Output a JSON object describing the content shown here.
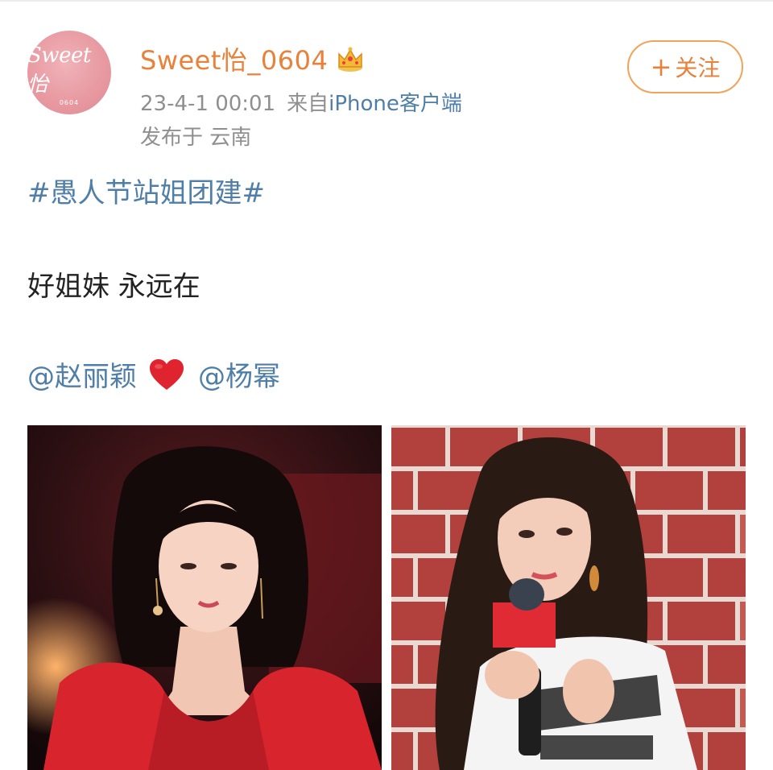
{
  "post": {
    "author": {
      "name": "Sweet怡_0604",
      "avatar_text": "Sweet怡",
      "avatar_sub": "0604"
    },
    "meta": {
      "time": "23-4-1 00:01",
      "source_prefix": "来自",
      "client": "iPhone客户端",
      "location": "发布于 云南"
    },
    "follow_button": {
      "plus": "+",
      "label": "关注"
    },
    "hashtag": "#愚人节站姐团建#",
    "text": "好姐妹 永远在",
    "mentions": [
      "@赵丽颖",
      "@杨幂"
    ],
    "icons": {
      "crown": "crown-icon",
      "heart": "red-heart-icon"
    },
    "colors": {
      "username": "#e8813a",
      "link": "#4f7ea8",
      "meta": "#8f8f8f",
      "follow_border": "#f0a45a",
      "heart": "#e0242f"
    }
  }
}
